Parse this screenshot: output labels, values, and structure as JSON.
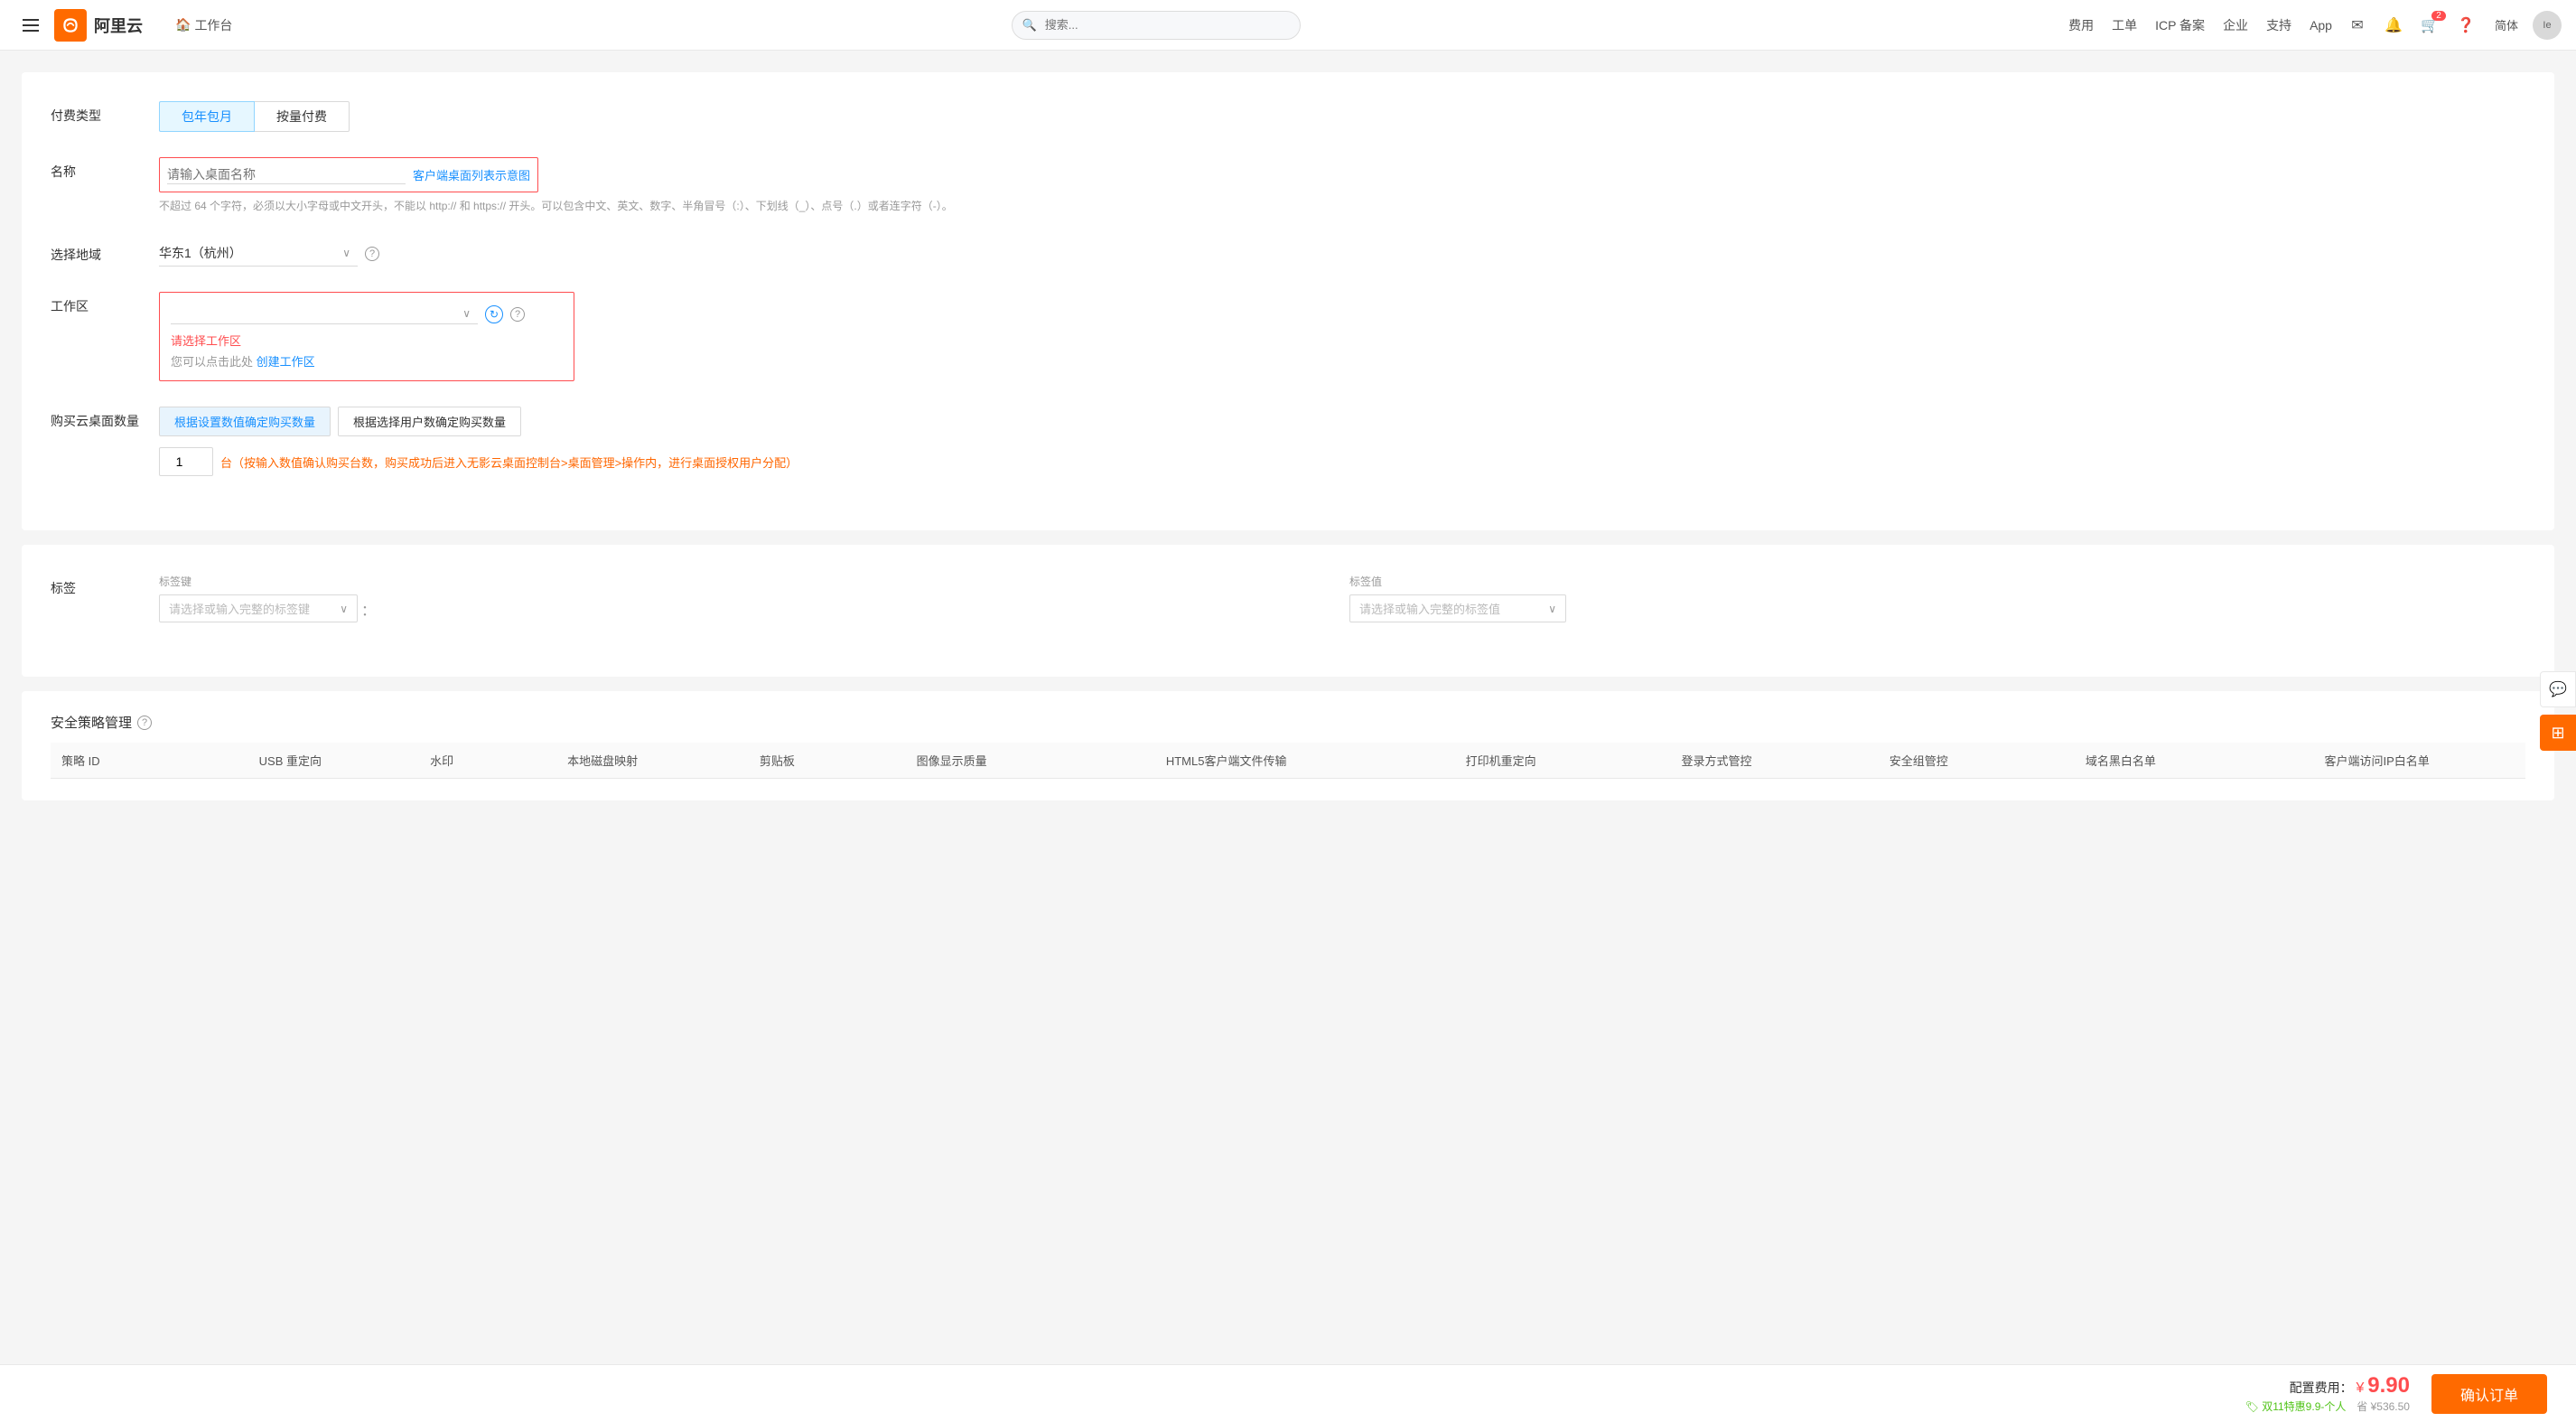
{
  "header": {
    "menu_label": "菜单",
    "logo_text": "阿里云",
    "workbench_label": "工作台",
    "search_placeholder": "搜索...",
    "nav_items": [
      "费用",
      "工单",
      "ICP 备案",
      "企业",
      "支持",
      "App"
    ],
    "lang_label": "简体",
    "cart_badge": "2",
    "user_initials": "Ie"
  },
  "form": {
    "pay_type_label": "付费类型",
    "pay_btn1": "包年包月",
    "pay_btn2": "按量付费",
    "name_label": "名称",
    "name_placeholder": "请输入桌面名称",
    "name_link": "客户端桌面列表示意图",
    "name_hint": "不超过 64 个字符，必须以大小字母或中文开头，不能以 http:// 和 https:// 开头。可以包含中文、英文、数字、半角冒号（:）、下划线（_）、点号（.）或者连字符（-）。",
    "region_label": "选择地域",
    "region_value": "华东1（杭州）",
    "workspace_label": "工作区",
    "workspace_placeholder": "",
    "workspace_error": "请选择工作区",
    "workspace_hint_prefix": "您可以点击此处",
    "workspace_hint_link": "创建工作区",
    "purchase_label": "购买云桌面数量",
    "purchase_btn1": "根据设置数值确定购买数量",
    "purchase_btn2": "根据选择用户数确定购买数量",
    "count_value": "1",
    "count_hint": "台（按输入数值确认购买台数，购买成功后进入无影云桌面控制台>桌面管理>操作内，进行桌面授权用户分配）",
    "tag_label": "标签",
    "tag_key_label": "标签键",
    "tag_key_placeholder": "请选择或输入完整的标签键",
    "tag_val_label": "标签值",
    "tag_val_placeholder": "请选择或输入完整的标签值",
    "security_label": "安全策略管理",
    "table_headers": [
      "策略 ID",
      "USB 重定向",
      "水印",
      "本地磁盘映射",
      "剪贴板",
      "图像显示质量",
      "HTML5客户端文件传输",
      "打印机重定向",
      "登录方式管控",
      "安全组管控",
      "域名黑白名单",
      "客户端访问IP白名单"
    ]
  },
  "footer": {
    "price_label": "配置费用：",
    "price_currency": "¥",
    "price_amount": "9.90",
    "discount_label": "🏷 双11特惠9.9-个人",
    "saving_label": "省 ¥536.50",
    "confirm_btn": "确认订单"
  },
  "float_btns": {
    "chat_icon": "💬",
    "qr_icon": "⊞"
  }
}
